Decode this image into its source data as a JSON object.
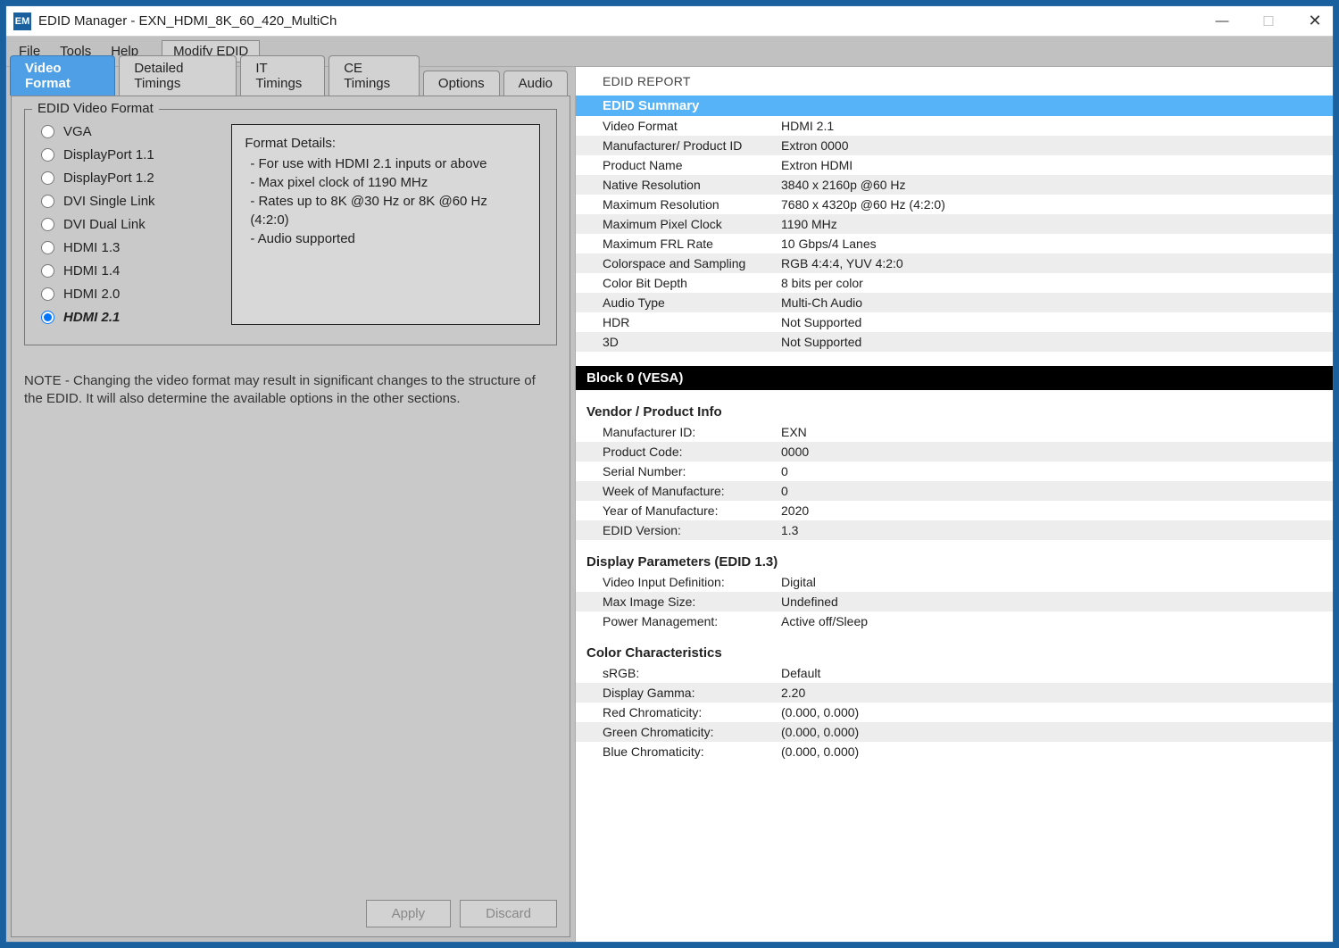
{
  "window": {
    "app_icon_text": "EM",
    "title": "EDID Manager - EXN_HDMI_8K_60_420_MultiCh"
  },
  "menu": {
    "file": "File",
    "tools": "Tools",
    "help": "Help",
    "modify": "Modify EDID"
  },
  "tabs": {
    "video_format": "Video Format",
    "detailed_timings": "Detailed Timings",
    "it_timings": "IT Timings",
    "ce_timings": "CE Timings",
    "options": "Options",
    "audio": "Audio"
  },
  "left": {
    "group_label": "EDID Video Format",
    "radios": {
      "vga": "VGA",
      "dp11": "DisplayPort 1.1",
      "dp12": "DisplayPort 1.2",
      "dvi_s": "DVI Single Link",
      "dvi_d": "DVI Dual Link",
      "hdmi13": "HDMI 1.3",
      "hdmi14": "HDMI 1.4",
      "hdmi20": "HDMI 2.0",
      "hdmi21": "HDMI 2.1"
    },
    "details": {
      "header": "Format Details:",
      "l1": "- For use with HDMI 2.1 inputs or above",
      "l2": "- Max pixel clock of 1190 MHz",
      "l3": "- Rates up to 8K @30 Hz or 8K @60 Hz (4:2:0)",
      "l4": "- Audio supported"
    },
    "note": "NOTE - Changing the video format may result in significant changes to the structure of the EDID. It will also determine the available options in the other sections.",
    "apply": "Apply",
    "discard": "Discard"
  },
  "report": {
    "header": "EDID REPORT",
    "summary_header": "EDID Summary",
    "summary": [
      {
        "k": "Video Format",
        "v": "HDMI 2.1"
      },
      {
        "k": "Manufacturer/ Product ID",
        "v": "Extron 0000"
      },
      {
        "k": "Product Name",
        "v": "Extron HDMI"
      },
      {
        "k": "Native Resolution",
        "v": "3840 x 2160p @60 Hz"
      },
      {
        "k": "Maximum Resolution",
        "v": "7680 x 4320p @60 Hz (4:2:0)"
      },
      {
        "k": "Maximum Pixel Clock",
        "v": "1190 MHz"
      },
      {
        "k": "Maximum FRL Rate",
        "v": "10 Gbps/4 Lanes"
      },
      {
        "k": "Colorspace and Sampling",
        "v": "RGB 4:4:4, YUV 4:2:0"
      },
      {
        "k": "Color Bit Depth",
        "v": "8 bits per color"
      },
      {
        "k": "Audio Type",
        "v": "Multi-Ch Audio"
      },
      {
        "k": "HDR",
        "v": "Not Supported"
      },
      {
        "k": "3D",
        "v": "Not Supported"
      }
    ],
    "block0_header": "Block 0 (VESA)",
    "sections": [
      {
        "title": "Vendor / Product Info",
        "rows": [
          {
            "k": "Manufacturer ID:",
            "v": "EXN"
          },
          {
            "k": "Product Code:",
            "v": "0000"
          },
          {
            "k": "Serial Number:",
            "v": "0"
          },
          {
            "k": "Week of Manufacture:",
            "v": "0"
          },
          {
            "k": "Year of Manufacture:",
            "v": "2020"
          },
          {
            "k": "EDID Version:",
            "v": "1.3"
          }
        ]
      },
      {
        "title": "Display Parameters (EDID 1.3)",
        "rows": [
          {
            "k": "Video Input Definition:",
            "v": "Digital"
          },
          {
            "k": "Max Image Size:",
            "v": "Undefined"
          },
          {
            "k": "Power Management:",
            "v": "Active off/Sleep"
          }
        ]
      },
      {
        "title": "Color Characteristics",
        "rows": [
          {
            "k": "sRGB:",
            "v": "Default"
          },
          {
            "k": "Display Gamma:",
            "v": "2.20"
          },
          {
            "k": "Red Chromaticity:",
            "v": "(0.000, 0.000)"
          },
          {
            "k": "Green Chromaticity:",
            "v": "(0.000, 0.000)"
          },
          {
            "k": "Blue Chromaticity:",
            "v": "(0.000, 0.000)"
          }
        ]
      }
    ]
  }
}
